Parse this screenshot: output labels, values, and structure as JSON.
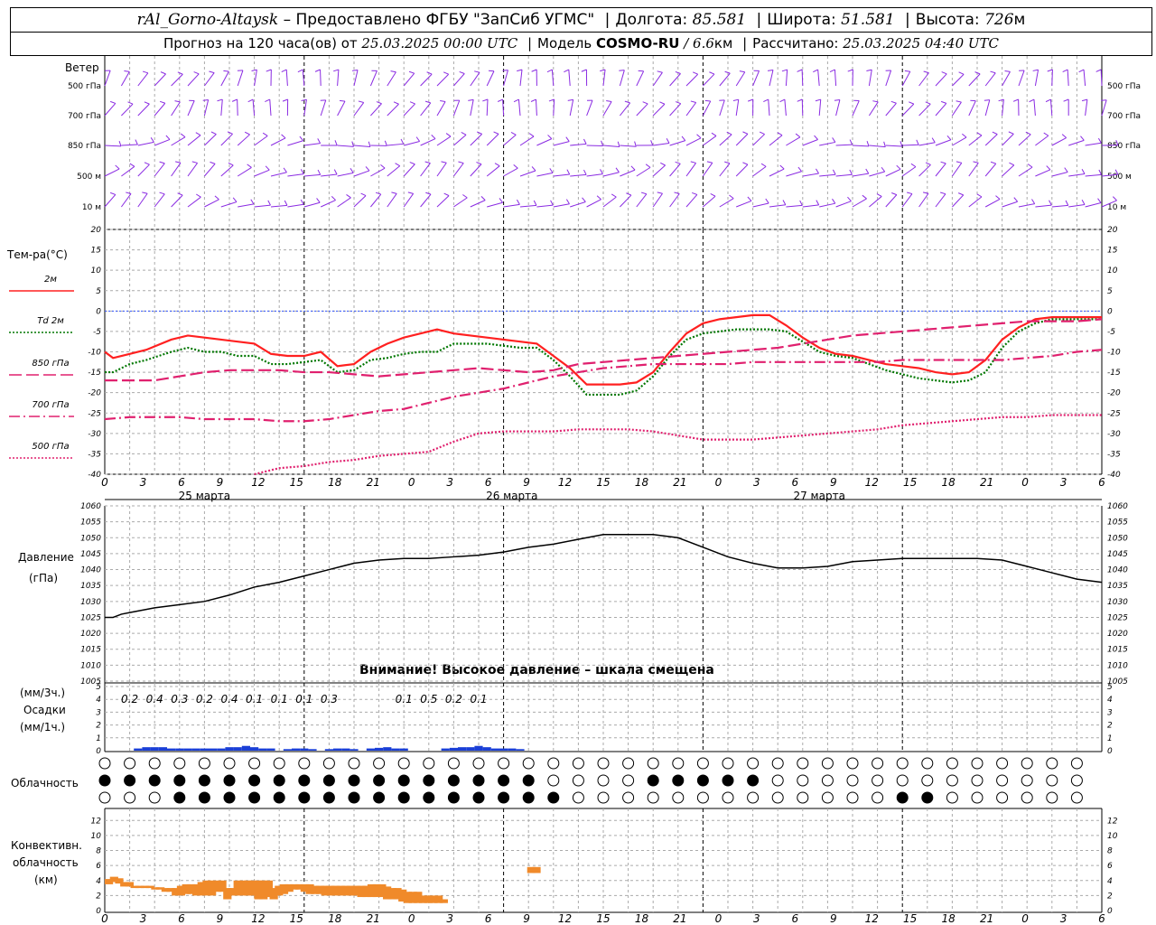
{
  "header": {
    "station": "rAl_Gorno-Altaysk",
    "provider": "– Предоставлено ФГБУ \"ЗапСиб УГМС\"",
    "lon_label": "Долгота:",
    "lon": "85.581",
    "lat_label": "Широта:",
    "lat": "51.581",
    "alt_label": "Высота:",
    "alt": "726",
    "alt_unit": "м",
    "forecast_label": "Прогноз на 120 часа(ов) от",
    "forecast_from": "25.03.2025 00:00 UTC",
    "model_label": "Модель",
    "model": "COSMO-RU",
    "model_res": "/ 6.6",
    "model_res_unit": "км",
    "calc_label": "Рассчитано:",
    "calc_time": "25.03.2025 04:40 UTC"
  },
  "wind": {
    "title": "Ветер",
    "levels": [
      "500 гПа",
      "700 гПа",
      "850 гПа",
      "500 м",
      "10  м"
    ],
    "color": "#8a2be2"
  },
  "temperature": {
    "title": "Тем-ра(°C)",
    "legend": [
      {
        "label": "2м",
        "color": "#ff2020",
        "style": "solid"
      },
      {
        "label": "Td  2м",
        "color": "#007700",
        "style": "dotted"
      },
      {
        "label": "850 гПа",
        "color": "#e0206e",
        "style": "longdash"
      },
      {
        "label": "700 гПа",
        "color": "#e0206e",
        "style": "dashdot"
      },
      {
        "label": "500 гПа",
        "color": "#e0206e",
        "style": "dotted"
      }
    ],
    "yticks": [
      20,
      15,
      10,
      5,
      0,
      -5,
      -10,
      -15,
      -20,
      -25,
      -30,
      -35,
      -40
    ]
  },
  "time_axis": {
    "hours": [
      "0",
      "3",
      "6",
      "9",
      "12",
      "15",
      "18",
      "21",
      "0",
      "3",
      "6",
      "9",
      "12",
      "15",
      "18",
      "21",
      "0",
      "3",
      "6",
      "9",
      "12",
      "15",
      "18",
      "21",
      "0",
      "3",
      "6"
    ],
    "dates": [
      "25 марта",
      "26 марта",
      "27 марта"
    ]
  },
  "pressure": {
    "title": "Давление",
    "unit": "(гПа)",
    "yticks": [
      1060,
      1055,
      1050,
      1045,
      1040,
      1035,
      1030,
      1025,
      1020,
      1015,
      1010,
      1005
    ],
    "warning": "Внимание! Высокое давление – шкала смещена"
  },
  "precip": {
    "label_top": "(мм/3ч.)",
    "label_mid": "Осадки",
    "label_bot": "(мм/1ч.)",
    "yticks": [
      5,
      4,
      3,
      2,
      1,
      0
    ],
    "amounts": [
      {
        "h": 3,
        "v": "0.2"
      },
      {
        "h": 6,
        "v": "0.4"
      },
      {
        "h": 9,
        "v": "0.3"
      },
      {
        "h": 12,
        "v": "0.2"
      },
      {
        "h": 15,
        "v": "0.4"
      },
      {
        "h": 18,
        "v": "0.1"
      },
      {
        "h": 21,
        "v": "0.1"
      },
      {
        "h": 24,
        "v": "0.1"
      },
      {
        "h": 27,
        "v": "0.3"
      },
      {
        "h": 36,
        "v": "0.1"
      },
      {
        "h": 39,
        "v": "0.5"
      },
      {
        "h": 42,
        "v": "0.2"
      },
      {
        "h": 45,
        "v": "0.1"
      }
    ],
    "bar_color": "#1a3fd6"
  },
  "clouds": {
    "title": "Облачность"
  },
  "convective": {
    "title1": "Конвективн.",
    "title2": "облачность",
    "title3": "(км)",
    "yticks": [
      12,
      10,
      8,
      6,
      4,
      2,
      0
    ],
    "color": "#f08a2a"
  },
  "chart_data": [
    {
      "type": "line",
      "title": "Тем-ра(°C)",
      "x_unit": "hours from 25.03.2025 00:00 UTC",
      "ylim": [
        -40,
        20
      ],
      "series": [
        {
          "name": "2м",
          "x": [
            0,
            1,
            3,
            5,
            8,
            10,
            12,
            14,
            16,
            18,
            20,
            22,
            24,
            26,
            28,
            30,
            32,
            34,
            36,
            38,
            40,
            42,
            44,
            46,
            48,
            50,
            52,
            54,
            56,
            58,
            60,
            62,
            64,
            66,
            68,
            70,
            72,
            74,
            76,
            78,
            80,
            82,
            84,
            86,
            88,
            90,
            92,
            94,
            96,
            98,
            100,
            102,
            104,
            106,
            108,
            110,
            112,
            114,
            116,
            118,
            120
          ],
          "y": [
            -10,
            -11.5,
            -10.5,
            -9.5,
            -7,
            -6,
            -6.5,
            -7,
            -7.5,
            -8,
            -10.5,
            -11,
            -11,
            -10,
            -13.5,
            -13,
            -10,
            -8,
            -6.5,
            -5.5,
            -4.5,
            -5.5,
            -6,
            -6.5,
            -7,
            -7.5,
            -8,
            -11,
            -14,
            -18,
            -18,
            -18,
            -17.5,
            -15,
            -10,
            -5.5,
            -3,
            -2,
            -1.5,
            -1,
            -1,
            -3.5,
            -6.5,
            -9,
            -10.5,
            -11,
            -12,
            -13,
            -13.5,
            -14,
            -15,
            -15.5,
            -15,
            -12,
            -7,
            -4,
            -2,
            -1.5,
            -1.5,
            -1.5,
            -1.5
          ]
        },
        {
          "name": "Td  2м",
          "x": [
            0,
            1,
            3,
            5,
            8,
            10,
            12,
            14,
            16,
            18,
            20,
            22,
            24,
            26,
            28,
            30,
            32,
            34,
            36,
            38,
            40,
            42,
            44,
            46,
            48,
            50,
            52,
            54,
            56,
            58,
            60,
            62,
            64,
            66,
            68,
            70,
            72,
            74,
            76,
            78,
            80,
            82,
            84,
            86,
            88,
            90,
            92,
            94,
            96,
            98,
            100,
            102,
            104,
            106,
            108,
            110,
            112,
            114,
            116,
            118,
            120
          ],
          "y": [
            -15,
            -15,
            -13,
            -12,
            -10,
            -9,
            -10,
            -10,
            -11,
            -11,
            -13,
            -13,
            -12.5,
            -12,
            -15,
            -14.5,
            -12,
            -11.5,
            -10.5,
            -10,
            -10,
            -8,
            -8,
            -8,
            -8.5,
            -9,
            -9,
            -12,
            -16,
            -20.5,
            -20.5,
            -20.5,
            -19.5,
            -16,
            -11,
            -7,
            -5.5,
            -5,
            -4.5,
            -4.5,
            -4.5,
            -5,
            -7.5,
            -10,
            -11,
            -11.5,
            -13,
            -14.5,
            -15.5,
            -16.5,
            -17,
            -17.5,
            -17,
            -15,
            -9,
            -5,
            -3,
            -2,
            -2,
            -2,
            -2
          ]
        },
        {
          "name": "850 гПа",
          "x": [
            0,
            6,
            9,
            12,
            15,
            18,
            21,
            24,
            27,
            30,
            33,
            36,
            39,
            42,
            45,
            48,
            51,
            54,
            57,
            60,
            63,
            66,
            69,
            72,
            75,
            78,
            81,
            84,
            87,
            90,
            93,
            96,
            99,
            102,
            105,
            108,
            111,
            114,
            117,
            120
          ],
          "y": [
            -17,
            -17,
            -16,
            -15,
            -14.5,
            -14.5,
            -14.5,
            -15,
            -15,
            -15.5,
            -16,
            -15.5,
            -15,
            -14.5,
            -14,
            -14.5,
            -15,
            -14.5,
            -13,
            -12.5,
            -12,
            -11.5,
            -11,
            -10.5,
            -10,
            -9.5,
            -9,
            -8,
            -7,
            -6,
            -5.5,
            -5,
            -4.5,
            -4,
            -3.5,
            -3,
            -2.5,
            -2.5,
            -2.5,
            -2
          ]
        },
        {
          "name": "700 гПа",
          "x": [
            0,
            3,
            6,
            9,
            12,
            15,
            18,
            21,
            24,
            27,
            30,
            33,
            36,
            39,
            42,
            45,
            48,
            51,
            54,
            57,
            60,
            63,
            66,
            69,
            72,
            75,
            78,
            81,
            84,
            87,
            90,
            93,
            96,
            99,
            102,
            105,
            108,
            111,
            114,
            117,
            120
          ],
          "y": [
            -26.5,
            -26,
            -26,
            -26,
            -26.5,
            -26.5,
            -26.5,
            -27,
            -27,
            -26.5,
            -25.5,
            -24.5,
            -24,
            -22.5,
            -21,
            -20,
            -19,
            -17.5,
            -16,
            -15,
            -14,
            -13.5,
            -13,
            -13,
            -13,
            -13,
            -12.5,
            -12.5,
            -12.5,
            -12.5,
            -12.5,
            -12.5,
            -12,
            -12,
            -12,
            -12,
            -12,
            -11.5,
            -11,
            -10,
            -9.5
          ]
        },
        {
          "name": "500 гПа",
          "x": [
            18,
            21,
            24,
            27,
            30,
            33,
            36,
            39,
            42,
            45,
            48,
            51,
            54,
            57,
            60,
            63,
            66,
            69,
            72,
            75,
            78,
            81,
            84,
            87,
            90,
            93,
            96,
            99,
            102,
            105,
            108,
            111,
            114,
            117,
            120
          ],
          "y": [
            -40,
            -38.5,
            -38,
            -37,
            -36.5,
            -35.5,
            -35,
            -34.5,
            -32,
            -30,
            -29.5,
            -29.5,
            -29.5,
            -29,
            -29,
            -29,
            -29.5,
            -30.5,
            -31.5,
            -31.5,
            -31.5,
            -31,
            -30.5,
            -30,
            -29.5,
            -29,
            -28,
            -27.5,
            -27,
            -26.5,
            -26,
            -26,
            -25.5,
            -25.5,
            -25.5
          ]
        }
      ]
    },
    {
      "type": "line",
      "title": "Давление",
      "ylabel": "(гПа)",
      "ylim": [
        1005,
        1060
      ],
      "x": [
        0,
        1,
        2,
        3,
        6,
        9,
        12,
        15,
        18,
        21,
        24,
        27,
        30,
        33,
        36,
        39,
        42,
        45,
        48,
        51,
        54,
        57,
        60,
        63,
        66,
        69,
        72,
        75,
        78,
        81,
        84,
        87,
        90,
        93,
        96,
        99,
        102,
        105,
        108,
        111,
        114,
        117,
        120
      ],
      "y": [
        1025,
        1025,
        1026,
        1026.5,
        1028,
        1029,
        1030,
        1032,
        1034.5,
        1036,
        1038,
        1040,
        1042,
        1043,
        1043.5,
        1043.5,
        1044,
        1044.5,
        1045.5,
        1047,
        1048,
        1049.5,
        1051,
        1051,
        1051,
        1050,
        1047,
        1044,
        1042,
        1040.5,
        1040.5,
        1041,
        1042.5,
        1043,
        1043.5,
        1043.5,
        1043.5,
        1043.5,
        1043,
        1041,
        1039,
        1037,
        1036
      ]
    },
    {
      "type": "bar",
      "title": "Осадки",
      "ylabel": "(мм/1ч.)",
      "ylim": [
        0,
        5
      ],
      "x": [
        4,
        5,
        6,
        7,
        8,
        9,
        10,
        11,
        12,
        13,
        14,
        15,
        16,
        17,
        18,
        19,
        20,
        21,
        22,
        23,
        24,
        25,
        26,
        27,
        28,
        29,
        30,
        31,
        32,
        33,
        34,
        35,
        36,
        37,
        38,
        39,
        40,
        41,
        42,
        43,
        44,
        45,
        46,
        47,
        48,
        49,
        50
      ],
      "values": [
        0.1,
        0.2,
        0.2,
        0.2,
        0.1,
        0.1,
        0.1,
        0.1,
        0.1,
        0.1,
        0.1,
        0.2,
        0.2,
        0.3,
        0.2,
        0.1,
        0.1,
        0,
        0.05,
        0.1,
        0.1,
        0.05,
        0,
        0.05,
        0.1,
        0.1,
        0.05,
        0,
        0.1,
        0.15,
        0.2,
        0.1,
        0.1,
        0,
        0,
        0,
        0,
        0.1,
        0.15,
        0.2,
        0.2,
        0.3,
        0.2,
        0.1,
        0.1,
        0.1,
        0.05
      ]
    },
    {
      "type": "bar",
      "title": "Конвективн. облачность",
      "ylabel": "(км)",
      "ylim": [
        0,
        13
      ],
      "x": [
        0,
        1,
        2,
        3,
        4,
        5,
        6,
        7,
        8,
        9,
        10,
        11,
        12,
        13,
        14,
        15,
        16,
        17,
        18,
        19,
        20,
        21,
        22,
        23,
        24,
        25,
        26,
        27,
        28,
        29,
        30,
        31,
        32,
        33,
        34,
        35,
        36,
        37,
        38,
        39,
        40,
        41,
        42,
        43,
        44,
        45,
        46,
        47,
        48,
        49,
        50,
        51,
        52,
        53,
        54,
        55,
        56,
        57,
        58,
        59,
        60,
        61,
        62,
        63,
        64,
        65,
        66,
        67,
        68,
        69,
        70,
        71,
        72,
        73,
        74,
        75,
        76,
        77,
        78,
        79,
        80,
        81,
        82,
        83
      ],
      "values": [
        [
          3.5,
          4.2
        ],
        [
          3.8,
          4.5
        ],
        [
          3.6,
          4.3
        ],
        [
          3.2,
          3.8
        ],
        [
          3.2,
          3.8
        ],
        [
          3,
          3.3
        ],
        [
          3,
          3.3
        ],
        [
          3,
          3.3
        ],
        [
          3,
          3.3
        ],
        [
          2.8,
          3.1
        ],
        [
          2.8,
          3.1
        ],
        [
          2.5,
          3
        ],
        [
          2.5,
          3
        ],
        [
          2,
          3
        ],
        [
          2,
          3.3
        ],
        [
          2.2,
          3.5
        ],
        [
          2.2,
          3.5
        ],
        [
          2,
          3.5
        ],
        [
          2,
          3.8
        ],
        [
          2,
          4
        ],
        [
          2,
          4
        ],
        [
          2.5,
          4
        ],
        [
          2.5,
          4
        ],
        [
          1.5,
          3
        ],
        [
          2,
          3
        ],
        [
          2,
          4
        ],
        [
          2,
          4
        ],
        [
          2,
          4
        ],
        [
          2,
          4
        ],
        [
          1.5,
          4
        ],
        [
          1.5,
          4
        ],
        [
          1.8,
          4
        ],
        [
          1.5,
          3
        ],
        [
          2,
          3.3
        ],
        [
          2.2,
          3.5
        ],
        [
          2.5,
          3.5
        ],
        [
          2.8,
          3.5
        ],
        [
          2.8,
          3.5
        ],
        [
          2.5,
          3.5
        ],
        [
          2.2,
          3.5
        ],
        [
          2.2,
          3.3
        ],
        [
          2.2,
          3.3
        ],
        [
          2,
          3.3
        ],
        [
          2,
          3.3
        ],
        [
          2,
          3.3
        ],
        [
          2,
          3.3
        ],
        [
          2,
          3.3
        ],
        [
          2,
          3.3
        ],
        [
          2,
          3.3
        ],
        [
          1.8,
          3.3
        ],
        [
          1.8,
          3.3
        ],
        [
          1.8,
          3.5
        ],
        [
          1.8,
          3.5
        ],
        [
          1.8,
          3.5
        ],
        [
          1.5,
          3.2
        ],
        [
          1.5,
          3
        ],
        [
          1.5,
          3
        ],
        [
          1.2,
          2.8
        ],
        [
          1,
          2.5
        ],
        [
          1,
          2.5
        ],
        [
          1,
          2.5
        ],
        [
          1,
          2
        ],
        [
          1,
          2
        ],
        [
          1,
          2
        ],
        [
          1,
          2
        ],
        [
          1,
          1.5
        ],
        [
          0,
          0
        ],
        [
          0,
          0
        ],
        [
          0,
          0
        ],
        [
          0,
          0
        ],
        [
          0,
          0
        ],
        [
          0,
          0
        ],
        [
          0,
          0
        ],
        [
          0,
          0
        ],
        [
          0,
          0
        ],
        [
          0,
          0
        ],
        [
          0,
          0
        ],
        [
          0,
          0
        ],
        [
          0,
          0
        ],
        [
          0,
          0
        ],
        [
          0,
          0
        ],
        [
          0,
          0
        ],
        [
          5,
          5.8
        ],
        [
          5,
          5.8
        ]
      ]
    }
  ]
}
